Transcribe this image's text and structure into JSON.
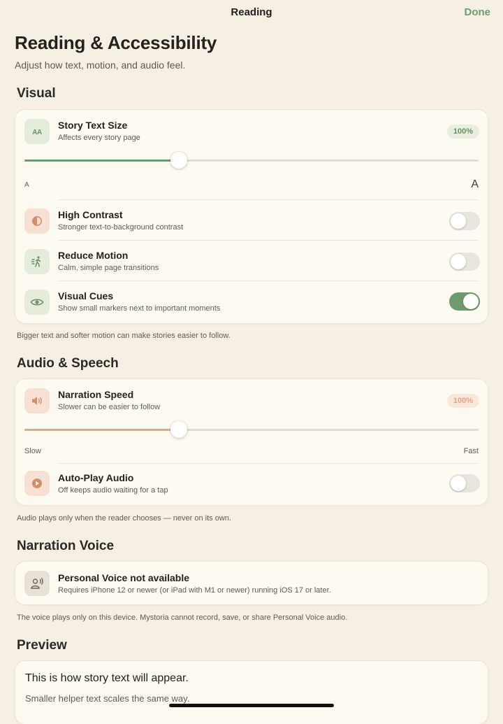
{
  "navbar": {
    "title": "Reading",
    "done_label": "Done"
  },
  "header": {
    "title": "Reading & Accessibility",
    "subtitle": "Adjust how text, motion, and audio feel."
  },
  "visual": {
    "section_title": "Visual",
    "text_size": {
      "icon": "text-size-icon",
      "icon_text": "AA",
      "title": "Story Text Size",
      "subtitle": "Affects every story page",
      "value_label": "100%",
      "slider_fraction": 0.34,
      "min_label": "A",
      "max_label": "A"
    },
    "high_contrast": {
      "icon": "contrast-icon",
      "title": "High Contrast",
      "subtitle": "Stronger text-to-background contrast",
      "enabled": false
    },
    "reduce_motion": {
      "icon": "motion-icon",
      "title": "Reduce Motion",
      "subtitle": "Calm, simple page transitions",
      "enabled": false
    },
    "visual_cues": {
      "icon": "eye-icon",
      "title": "Visual Cues",
      "subtitle": "Show small markers next to important moments",
      "enabled": true
    },
    "footnote": "Bigger text and softer motion can make stories easier to follow."
  },
  "audio": {
    "section_title": "Audio & Speech",
    "narration_speed": {
      "icon": "speaker-icon",
      "title": "Narration Speed",
      "subtitle": "Slower can be easier to follow",
      "value_label": "100%",
      "slider_fraction": 0.34,
      "min_label": "Slow",
      "max_label": "Fast"
    },
    "auto_play": {
      "icon": "play-icon",
      "title": "Auto-Play Audio",
      "subtitle": "Off keeps audio waiting for a tap",
      "enabled": false
    },
    "footnote": "Audio plays only when the reader chooses — never on its own."
  },
  "voice": {
    "section_title": "Narration Voice",
    "icon": "personal-voice-icon",
    "title": "Personal Voice not available",
    "subtitle": "Requires iPhone 12 or newer (or iPad with M1 or newer) running iOS 17 or later.",
    "footnote": "The voice plays only on this device. Mystoria cannot record, save, or share Personal Voice audio."
  },
  "preview": {
    "section_title": "Preview",
    "main_text": "This is how story text will appear.",
    "helper_text": "Smaller helper text scales the same way."
  },
  "colors": {
    "background": "#f6efe3",
    "accent_green": "#6f9a70",
    "accent_peach": "#e4a88c",
    "card": "#fdfaf2"
  }
}
